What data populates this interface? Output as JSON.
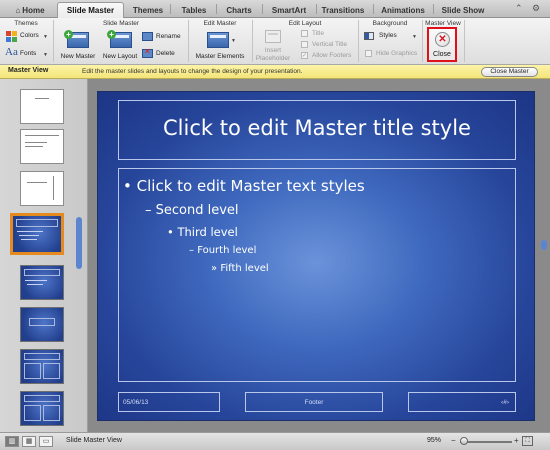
{
  "tabs": [
    {
      "label": "Home"
    },
    {
      "label": "Slide Master"
    },
    {
      "label": "Themes"
    },
    {
      "label": "Tables"
    },
    {
      "label": "Charts"
    },
    {
      "label": "SmartArt"
    },
    {
      "label": "Transitions"
    },
    {
      "label": "Animations"
    },
    {
      "label": "Slide Show"
    }
  ],
  "ribbon": {
    "themes": {
      "title": "Themes",
      "colors": "Colors",
      "fonts": "Fonts"
    },
    "slide_master": {
      "title": "Slide Master",
      "new_master": "New Master",
      "new_layout": "New Layout",
      "rename": "Rename",
      "delete": "Delete"
    },
    "edit_master": {
      "title": "Edit Master",
      "master_elements": "Master Elements"
    },
    "edit_layout": {
      "title": "Edit Layout",
      "insert_placeholder_1": "Insert",
      "insert_placeholder_2": "Placeholder",
      "title_cb": "Title",
      "vertical_title": "Vertical Title",
      "allow_footers": "Allow Footers"
    },
    "background": {
      "title": "Background",
      "styles": "Styles",
      "hide_graphics": "Hide Graphics"
    },
    "master_view": {
      "title": "Master View",
      "close": "Close"
    }
  },
  "message_bar": {
    "title": "Master View",
    "text": "Edit the master slides and layouts to change the design of your presentation.",
    "button": "Close Master"
  },
  "slide": {
    "title": "Click to edit Master title style",
    "levels": [
      "Click to edit Master text styles",
      "Second level",
      "Third level",
      "Fourth level",
      "Fifth level"
    ],
    "bullets": [
      "•",
      "–",
      "•",
      "–",
      "»"
    ],
    "date": "05/06/13",
    "footer": "Footer",
    "slide_number": "‹#›"
  },
  "status": {
    "view_label": "Slide Master View",
    "zoom": "95%"
  },
  "colors": {
    "accent_close": "#e0101a",
    "selection": "#e58a1f",
    "message_bar": "#fdf4a8",
    "slide_blue": "#26459a"
  }
}
